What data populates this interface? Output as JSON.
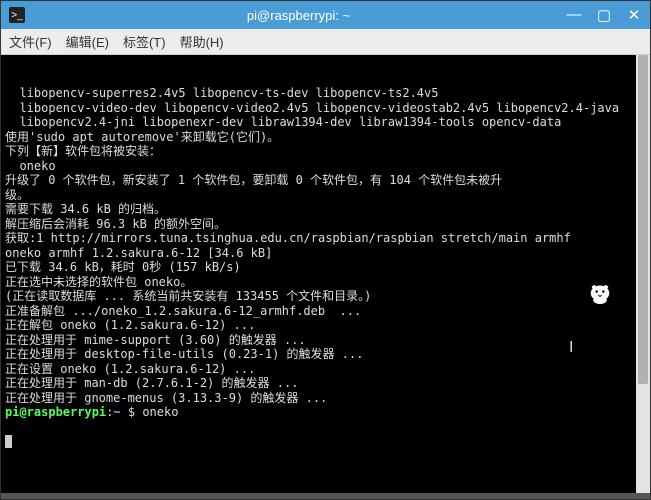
{
  "window": {
    "title": "pi@raspberrypi: ~"
  },
  "window_buttons": {
    "minimize": "—",
    "maximize": "▢",
    "close": "✕"
  },
  "menubar": {
    "file": "文件(F)",
    "edit": "编辑(E)",
    "tabs": "标签(T)",
    "help": "帮助(H)"
  },
  "terminal": {
    "lines": [
      "  libopencv-superres2.4v5 libopencv-ts-dev libopencv-ts2.4v5",
      "  libopencv-video-dev libopencv-video2.4v5 libopencv-videostab2.4v5 libopencv2.4-java",
      "  libopencv2.4-jni libopenexr-dev libraw1394-dev libraw1394-tools opencv-data",
      "使用'sudo apt autoremove'来卸载它(它们)。",
      "下列【新】软件包将被安装：",
      "  oneko",
      "升级了 0 个软件包，新安装了 1 个软件包，要卸载 0 个软件包，有 104 个软件包未被升",
      "级。",
      "需要下载 34.6 kB 的归档。",
      "解压缩后会消耗 96.3 kB 的额外空间。",
      "获取:1 http://mirrors.tuna.tsinghua.edu.cn/raspbian/raspbian stretch/main armhf",
      "oneko armhf 1.2.sakura.6-12 [34.6 kB]",
      "已下载 34.6 kB，耗时 0秒 (157 kB/s)",
      "正在选中未选择的软件包 oneko。",
      "(正在读取数据库 ... 系统当前共安装有 133455 个文件和目录。)",
      "正准备解包 .../oneko_1.2.sakura.6-12_armhf.deb  ...",
      "正在解包 oneko (1.2.sakura.6-12) ...",
      "正在处理用于 mime-support (3.60) 的触发器 ...",
      "正在处理用于 desktop-file-utils (0.23-1) 的触发器 ...",
      "正在设置 oneko (1.2.sakura.6-12) ...",
      "正在处理用于 man-db (2.7.6.1-2) 的触发器 ...",
      "正在处理用于 gnome-menus (3.13.3-9) 的触发器 ..."
    ],
    "prompt_user": "pi@raspberrypi",
    "prompt_colon": ":",
    "prompt_path": "~",
    "prompt_dollar": " $ ",
    "command": "oneko"
  },
  "icons": {
    "terminal_app": ">_",
    "text_cursor": "I"
  }
}
